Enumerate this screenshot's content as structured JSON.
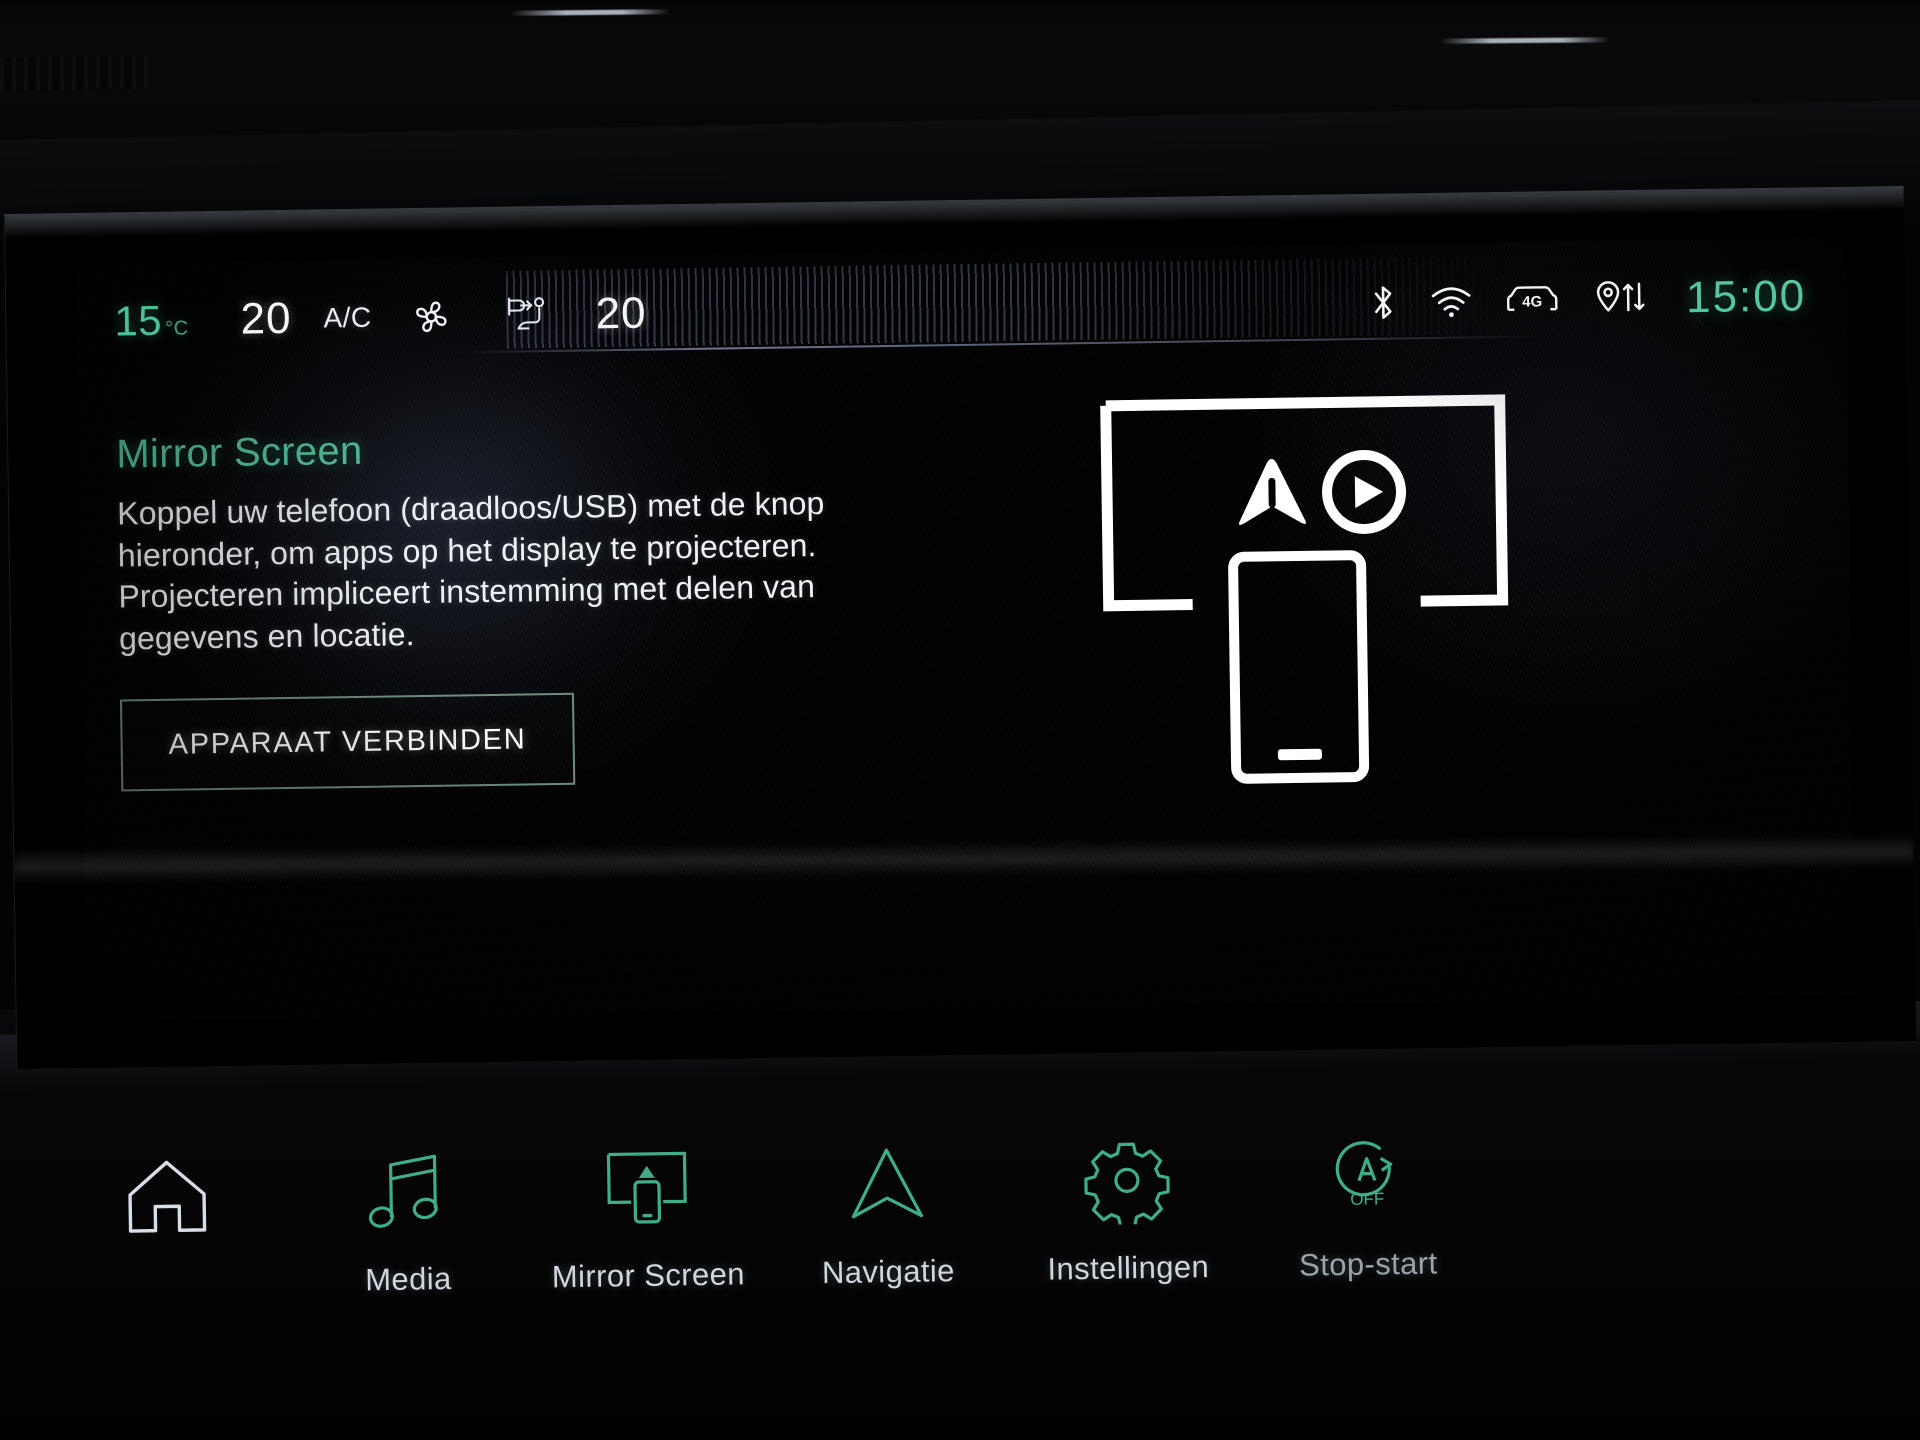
{
  "status_bar": {
    "exterior_temp": "15",
    "exterior_temp_unit": "°C",
    "driver_temp": "20",
    "ac_label": "A/C",
    "passenger_temp": "20",
    "fan_icon": "fan-icon",
    "airflow_icon": "airflow-seat-icon",
    "bluetooth_icon": "bluetooth-icon",
    "wifi_icon": "wifi-icon",
    "connectivity_icon": "car-4g-icon",
    "connectivity_label": "4G",
    "location_icon": "location-data-transfer-icon",
    "clock": "15:00"
  },
  "main": {
    "title": "Mirror Screen",
    "body": "Koppel uw telefoon (draadloos/USB) met de knop hieronder, om apps op het display te projecteren. Projecteren impliceert instemming met delen van gegevens en locatie.",
    "connect_button": "APPARAAT VERBINDEN",
    "illustration": {
      "name": "phone-projection-illustration",
      "screen_icon": "android-auto-arrow-icon",
      "play_icon": "play-circle-icon",
      "device_icon": "smartphone-icon"
    }
  },
  "nav_bar": {
    "items": [
      {
        "label": "",
        "icon": "home-icon",
        "name": "nav-home",
        "color": "#d8dee6"
      },
      {
        "label": "Media",
        "icon": "music-note-icon",
        "name": "nav-media",
        "color": "#3fae88"
      },
      {
        "label": "Mirror Screen",
        "icon": "mirror-screen-icon",
        "name": "nav-mirror-screen",
        "color": "#3fae88"
      },
      {
        "label": "Navigatie",
        "icon": "navigation-arrow-icon",
        "name": "nav-navigatie",
        "color": "#3fae88"
      },
      {
        "label": "Instellingen",
        "icon": "gear-icon",
        "name": "nav-instellingen",
        "color": "#3fae88"
      },
      {
        "label": "Stop-start",
        "icon": "stop-start-off-icon",
        "name": "nav-stop-start",
        "color": "#3fae88",
        "sub_label": "OFF"
      }
    ]
  },
  "colors": {
    "accent_green": "#3fae88",
    "title_green": "#56c6a0",
    "clock_green": "#55c79e",
    "text_white": "#eef1f5",
    "screen_black": "#000000"
  }
}
